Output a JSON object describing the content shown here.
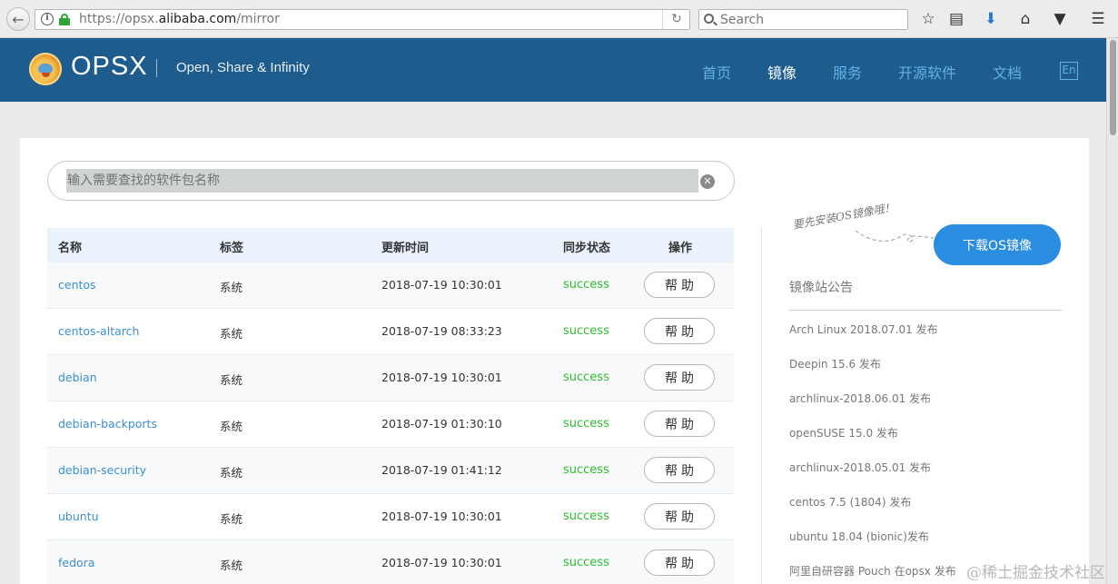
{
  "browser": {
    "url_prefix": "https://opsx.",
    "url_domain": "alibaba.com",
    "url_path": "/mirror",
    "search_placeholder": "Search"
  },
  "header": {
    "brand": "OPSX",
    "tagline": "Open, Share & Infinity",
    "nav": [
      {
        "label": "首页",
        "active": false
      },
      {
        "label": "镜像",
        "active": true
      },
      {
        "label": "服务",
        "active": false
      },
      {
        "label": "开源软件",
        "active": false
      },
      {
        "label": "文档",
        "active": false
      }
    ],
    "lang_toggle": "En"
  },
  "search": {
    "placeholder": "输入需要查找的软件包名称"
  },
  "table": {
    "columns": [
      "名称",
      "标签",
      "更新时间",
      "同步状态",
      "操作"
    ],
    "rows": [
      {
        "name": "centos",
        "tag": "系统",
        "time": "2018-07-19 10:30:01",
        "status": "success",
        "action": "帮助"
      },
      {
        "name": "centos-altarch",
        "tag": "系统",
        "time": "2018-07-19 08:33:23",
        "status": "success",
        "action": "帮助"
      },
      {
        "name": "debian",
        "tag": "系统",
        "time": "2018-07-19 10:30:01",
        "status": "success",
        "action": "帮助"
      },
      {
        "name": "debian-backports",
        "tag": "系统",
        "time": "2018-07-19 01:30:10",
        "status": "success",
        "action": "帮助"
      },
      {
        "name": "debian-security",
        "tag": "系统",
        "time": "2018-07-19 01:41:12",
        "status": "success",
        "action": "帮助"
      },
      {
        "name": "ubuntu",
        "tag": "系统",
        "time": "2018-07-19 10:30:01",
        "status": "success",
        "action": "帮助"
      },
      {
        "name": "fedora",
        "tag": "系统",
        "time": "2018-07-19 10:30:01",
        "status": "success",
        "action": "帮助"
      }
    ]
  },
  "sidebar": {
    "tip": "要先安装OS镜像哦！",
    "download_label": "下载OS镜像",
    "notice_title": "镜像站公告",
    "notices": [
      "Arch Linux 2018.07.01 发布",
      "Deepin 15.6 发布",
      "archlinux-2018.06.01 发布",
      "openSUSE 15.0 发布",
      "archlinux-2018.05.01 发布",
      "centos 7.5 (1804) 发布",
      "ubuntu 18.04 (bionic)发布",
      "阿里自研容器 Pouch 在opsx 发布"
    ]
  },
  "watermark": "@稀土掘金技术社区",
  "colors": {
    "header_bg": "#1d5c8c",
    "nav_link": "#63b0e8",
    "success": "#2ebd2e",
    "link": "#3b8fd1",
    "primary_button": "#2b8de0"
  }
}
